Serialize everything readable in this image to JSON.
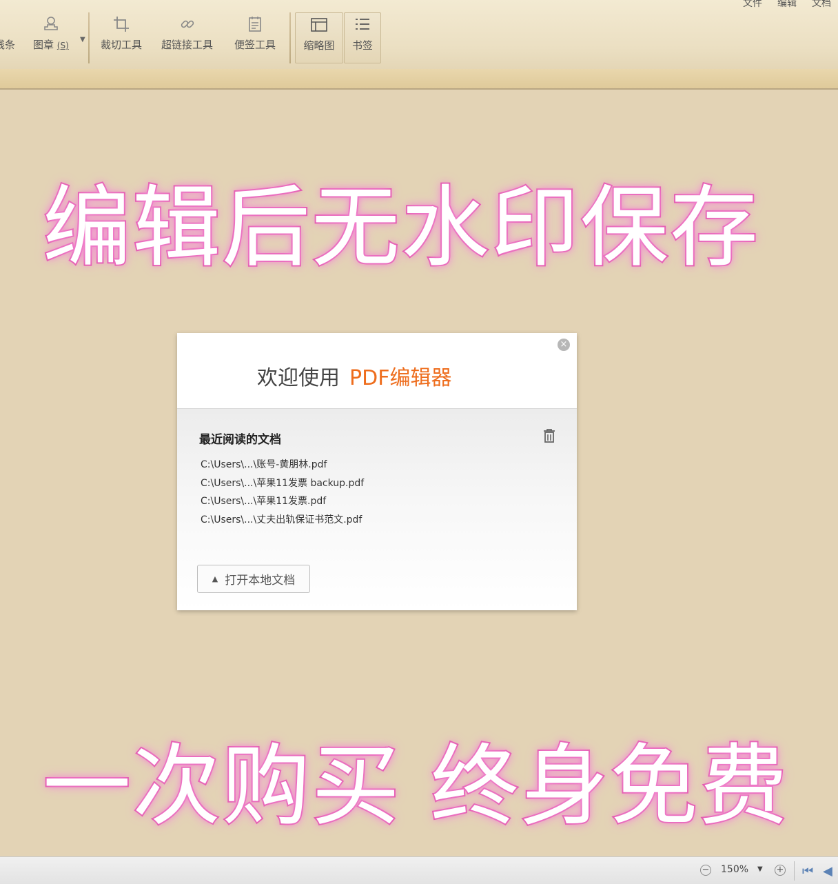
{
  "top_menu": [
    "文件",
    "编辑",
    "文档"
  ],
  "toolbar": {
    "lines_label": "线条",
    "stamp_label": "图章",
    "stamp_shortcut": "(S)",
    "crop_label": "裁切工具",
    "link_label": "超链接工具",
    "note_label": "便签工具",
    "thumbnail_label": "缩略图",
    "bookmark_label": "书签"
  },
  "promo": {
    "top_text": "编辑后无水印保存",
    "bottom_text": "一次购买 终身免费",
    "glow_color": "#e04aa7"
  },
  "dialog": {
    "welcome_text": "欢迎使用",
    "brand_text": "PDF编辑器",
    "brand_color": "#ee6d1d",
    "recent_title": "最近阅读的文档",
    "recent_files": [
      "C:\\Users\\...\\账号-黄朋林.pdf",
      "C:\\Users\\...\\苹果11发票 backup.pdf",
      "C:\\Users\\...\\苹果11发票.pdf",
      "C:\\Users\\...\\丈夫出轨保证书范文.pdf"
    ],
    "open_button": "打开本地文档"
  },
  "statusbar": {
    "zoom_value": "150%"
  }
}
